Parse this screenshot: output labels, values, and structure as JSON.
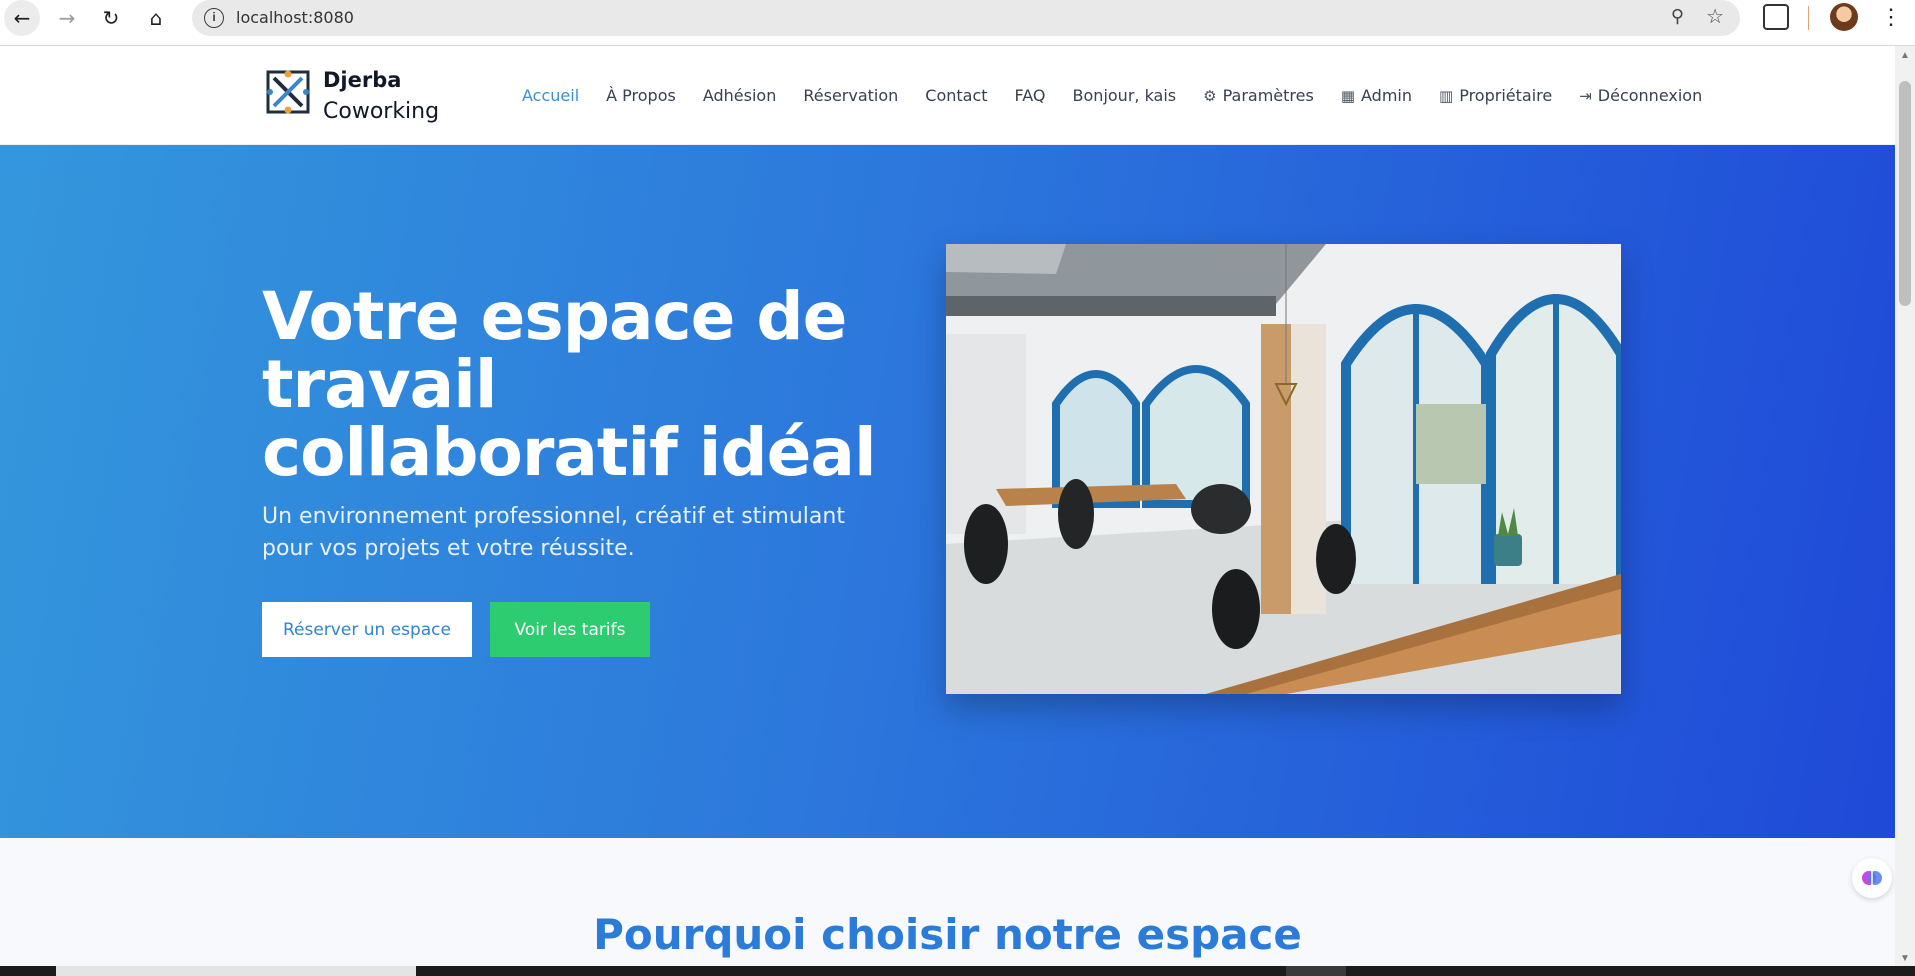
{
  "browser": {
    "url": "localhost:8080",
    "icons": [
      "back-arrow-icon",
      "forward-arrow-icon",
      "reload-icon",
      "home-icon",
      "info-icon",
      "zoom-icon",
      "star-icon",
      "extensions-icon",
      "profile-avatar",
      "menu-icon"
    ]
  },
  "header": {
    "brand_line1": "Djerba",
    "brand_line2": "Coworking",
    "nav": [
      {
        "label": "Accueil",
        "active": true
      },
      {
        "label": "À Propos"
      },
      {
        "label": "Adhésion"
      },
      {
        "label": "Réservation"
      },
      {
        "label": "Contact"
      },
      {
        "label": "FAQ"
      },
      {
        "label": "Bonjour, kais"
      },
      {
        "label": "Paramètres",
        "icon": "gear-icon"
      },
      {
        "label": "Admin",
        "icon": "dashboard-icon"
      },
      {
        "label": "Propriétaire",
        "icon": "building-icon"
      },
      {
        "label": "Déconnexion",
        "icon": "logout-icon"
      }
    ]
  },
  "hero": {
    "title": "Votre espace de travail collaboratif idéal",
    "subtitle": "Un environnement professionnel, créatif et stimulant pour vos projets et votre réussite.",
    "primary_button": "Réserver un espace",
    "secondary_button": "Voir les tarifs",
    "gradient_colors": [
      "#3497dc",
      "#1f49d8"
    ]
  },
  "section": {
    "title": "Pourquoi choisir notre espace"
  },
  "colors": {
    "accent": "#3b8fd8",
    "cta_green": "#2ecc71",
    "section_title": "#2b7bd8"
  }
}
